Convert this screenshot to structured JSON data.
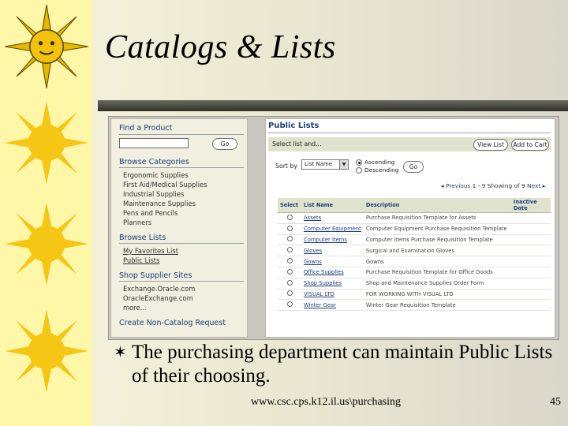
{
  "slide": {
    "title": "Catalogs & Lists",
    "bullet": "The purchasing department can maintain Public Lists of their choosing.",
    "bullet_glyph": "✶",
    "footer_url": "www.csc.cps.k12.il.us\\purchasing",
    "page_number": "45",
    "colors": {
      "left_strip": "#fff7a8",
      "sun": "#f6c614",
      "rule": "#3d3d34",
      "link": "#1b3f7a"
    }
  },
  "screenshot": {
    "left": {
      "find_heading": "Find a Product",
      "go_label": "Go",
      "browse_categories_heading": "Browse Categories",
      "categories": [
        "Ergonomic Supplies",
        "First Aid/Medical Supplies",
        "Industrial Supplies",
        "Maintenance Supplies",
        "Pens and Pencils",
        "Planners"
      ],
      "browse_lists_heading": "Browse Lists",
      "lists": [
        "My Favorites List",
        "Public Lists"
      ],
      "supplier_heading": "Shop Supplier Sites",
      "suppliers": [
        "Exchange.Oracle.com",
        "OracleExchange.com",
        "more..."
      ],
      "noncatalog_label": "Create Non-Catalog Request"
    },
    "right": {
      "title": "Public Lists",
      "select_text": "Select list and...",
      "view_label": "View List",
      "add_cart_label": "Add to Cart",
      "sort_label": "Sort by",
      "sort_value": "List Name",
      "ascending_label": "Ascending",
      "descending_label": "Descending",
      "go_label": "Go",
      "pager": {
        "prev": "Previous",
        "range": "1 - 9 Showing of 9",
        "next": "Next"
      },
      "columns": [
        "Select",
        "List Name",
        "Description",
        "Inactive Date"
      ],
      "rows": [
        {
          "name": "Assets",
          "description": "Purchase Requisition Template for Assets"
        },
        {
          "name": "Computer Equipment",
          "description": "Computer Equipment Purchase Requisition Template"
        },
        {
          "name": "Computer Items",
          "description": "Computer Items Purchase Requisition Template"
        },
        {
          "name": "Gloves",
          "description": "Surgical and Examination Gloves"
        },
        {
          "name": "Gowns",
          "description": "Gowns"
        },
        {
          "name": "Office Supplies",
          "description": "Purchase Requisition Template for Office Goods"
        },
        {
          "name": "Shop Supplies",
          "description": "Shop and Maintenance Supplies Order Form"
        },
        {
          "name": "VISUAL LTD",
          "description": "FOR WORKING WITH VISUAL LTD"
        },
        {
          "name": "Winter Gear",
          "description": "Winter Gear Requisition Template"
        }
      ]
    }
  }
}
